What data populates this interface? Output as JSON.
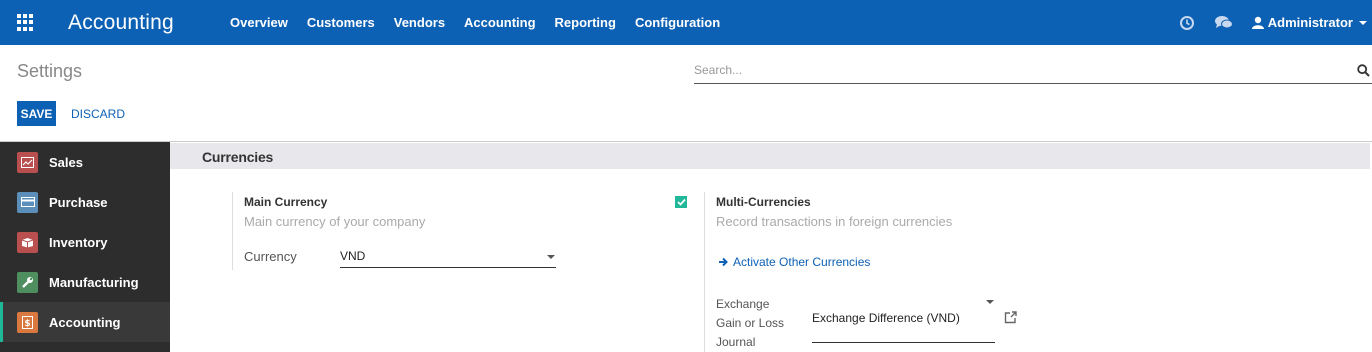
{
  "navbar": {
    "app_title": "Accounting",
    "menu": [
      "Overview",
      "Customers",
      "Vendors",
      "Accounting",
      "Reporting",
      "Configuration"
    ],
    "user_name": "Administrator",
    "icons": [
      "apps-grid-icon",
      "clock-icon",
      "chat-icon",
      "user-icon"
    ]
  },
  "control_panel": {
    "title": "Settings",
    "search_placeholder": "Search...",
    "save_label": "SAVE",
    "discard_label": "DISCARD"
  },
  "sidebar": {
    "items": [
      {
        "label": "Sales",
        "color": "#b94f4f"
      },
      {
        "label": "Purchase",
        "color": "#5b8fb9"
      },
      {
        "label": "Inventory",
        "color": "#b94f4f"
      },
      {
        "label": "Manufacturing",
        "color": "#4f8f5f"
      },
      {
        "label": "Accounting",
        "color": "#d9783f"
      }
    ],
    "active_index": 4
  },
  "section": {
    "title": "Currencies"
  },
  "main_currency": {
    "title": "Main Currency",
    "description": "Main currency of your company",
    "currency_label": "Currency",
    "currency_value": "VND"
  },
  "multi_currencies": {
    "checked": true,
    "title": "Multi-Currencies",
    "description": "Record transactions in foreign currencies",
    "activate_link": "Activate Other Currencies",
    "journal_label_lines": [
      "Exchange",
      "Gain or Loss",
      "Journal"
    ],
    "journal_value": "Exchange Difference (VND)"
  },
  "colors": {
    "brand": "#0d61b5",
    "accent": "#21b799",
    "sidebar_bg": "#2d2d2d"
  }
}
